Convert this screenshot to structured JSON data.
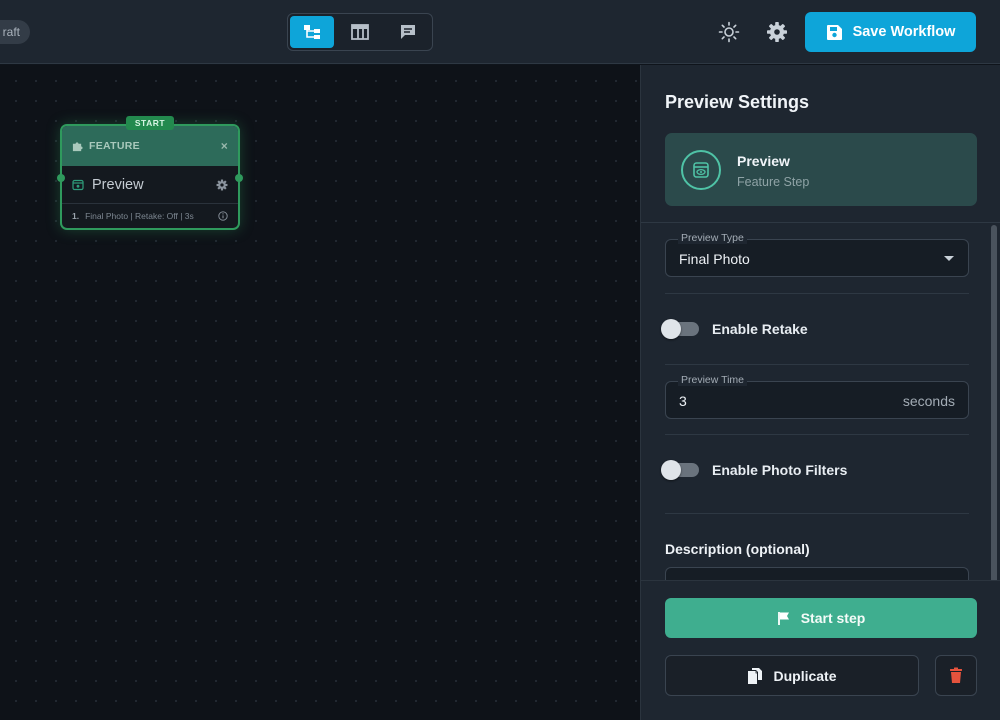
{
  "topbar": {
    "status_pill": "raft",
    "view_modes": [
      {
        "name": "tree-view",
        "active": true
      },
      {
        "name": "table-view",
        "active": false
      },
      {
        "name": "chat-view",
        "active": false
      }
    ],
    "save_label": "Save Workflow",
    "accent_color": "#0ea5d9"
  },
  "canvas": {
    "node": {
      "badge": "START",
      "type_label": "FEATURE",
      "close_glyph": "×",
      "title": "Preview",
      "meta_index": "1.",
      "meta_text": "Final Photo | Retake: Off | 3s"
    }
  },
  "panel": {
    "title": "Preview Settings",
    "step": {
      "name": "Preview",
      "subtitle": "Feature Step"
    },
    "preview_type": {
      "label": "Preview Type",
      "value": "Final Photo"
    },
    "enable_retake": {
      "label": "Enable Retake",
      "on": false
    },
    "preview_time": {
      "label": "Preview Time",
      "value": "3",
      "suffix": "seconds"
    },
    "enable_filters": {
      "label": "Enable Photo Filters",
      "on": false
    },
    "description_label": "Description (optional)",
    "start_step_label": "Start step",
    "duplicate_label": "Duplicate",
    "delete_color": "#e5533d"
  }
}
